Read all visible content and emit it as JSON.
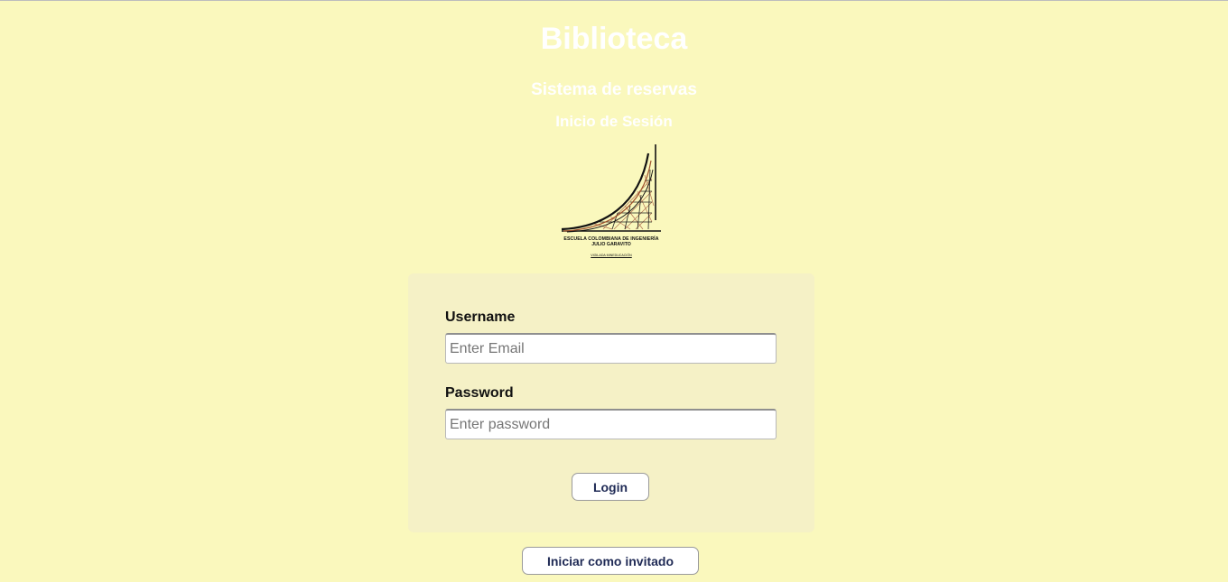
{
  "header": {
    "title": "Biblioteca",
    "subtitle": "Sistema de reservas",
    "section": "Inicio de Sesión"
  },
  "logo": {
    "line1": "ESCUELA COLOMBIANA DE INGENIERÍA",
    "line2": "JULIO GARAVITO",
    "line3": "VIGILADA MINEDUCACIÓN"
  },
  "login_form": {
    "username_label": "Username",
    "username_placeholder": "Enter Email",
    "username_value": "",
    "password_label": "Password",
    "password_placeholder": "Enter password",
    "password_value": "",
    "login_button": "Login"
  },
  "guest_button": "Iniciar como invitado",
  "colors": {
    "background": "#faf8bd",
    "card": "#f5f1c6",
    "button_text": "#1f2a55",
    "heading_text": "#ffffff"
  }
}
